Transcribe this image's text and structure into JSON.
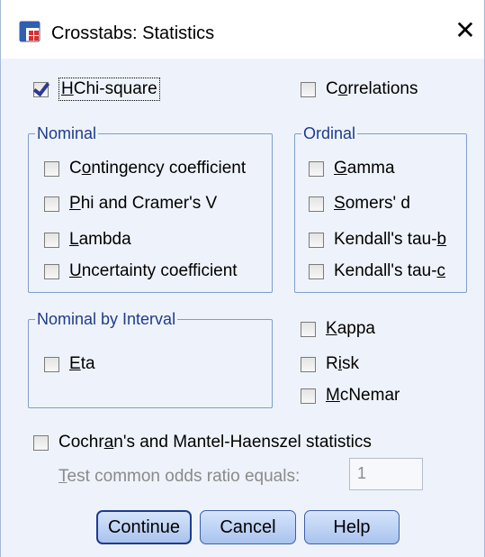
{
  "window": {
    "title": "Crosstabs: Statistics",
    "close_glyph": "✕"
  },
  "top": {
    "chi_square": {
      "label_pre": "",
      "label_u": "H",
      "label_post": "Chi-square",
      "checked": true
    },
    "correlations": {
      "label_pre": "C",
      "label_u": "o",
      "label_post": "rrelations",
      "checked": false
    }
  },
  "nominal": {
    "legend": "Nominal",
    "items": [
      {
        "pre": "C",
        "u": "o",
        "post": "ntingency coefficient",
        "checked": false
      },
      {
        "pre": "",
        "u": "P",
        "post": "hi and Cramer's V",
        "checked": false
      },
      {
        "pre": "",
        "u": "L",
        "post": "ambda",
        "checked": false
      },
      {
        "pre": "",
        "u": "U",
        "post": "ncertainty coefficient",
        "checked": false
      }
    ]
  },
  "ordinal": {
    "legend": "Ordinal",
    "items": [
      {
        "pre": "",
        "u": "G",
        "post": "amma",
        "checked": false
      },
      {
        "pre": "",
        "u": "S",
        "post": "omers' d",
        "checked": false
      },
      {
        "pre": "Kendall's tau-",
        "u": "b",
        "post": "",
        "checked": false
      },
      {
        "pre": "Kendall's tau-",
        "u": "c",
        "post": "",
        "checked": false
      }
    ]
  },
  "nominal_by_interval": {
    "legend": "Nominal by Interval",
    "items": [
      {
        "pre": "",
        "u": "E",
        "post": "ta",
        "checked": false
      }
    ]
  },
  "other": {
    "items": [
      {
        "pre": "",
        "u": "K",
        "post": "appa",
        "checked": false
      },
      {
        "pre": "R",
        "u": "i",
        "post": "sk",
        "checked": false
      },
      {
        "pre": "",
        "u": "M",
        "post": "cNemar",
        "checked": false
      }
    ]
  },
  "cochran": {
    "pre": "Cochr",
    "u": "a",
    "post": "n's and Mantel-Haenszel statistics",
    "checked": false,
    "odds_label_pre": "",
    "odds_label_u": "T",
    "odds_label_post": "est common odds ratio equals:",
    "odds_value": "1"
  },
  "buttons": {
    "continue": "Continue",
    "cancel": "Cancel",
    "help": "Help"
  }
}
